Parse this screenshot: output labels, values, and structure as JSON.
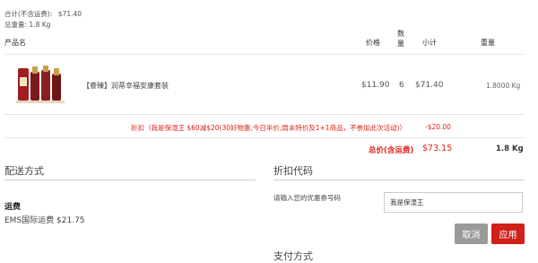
{
  "summary": {
    "subtotal_label": "合计(不含运费):",
    "subtotal_value": "$71.40",
    "weight_label": "总重量: 1.8 Kg"
  },
  "table": {
    "headers": {
      "product": "产品名",
      "price": "价格",
      "qty": "数\n量",
      "subtotal": "小计",
      "weight": "重量"
    },
    "rows": [
      {
        "name": "【睿臻】润蒂幸福安康套装",
        "price": "$11.90",
        "qty": "6",
        "subtotal": "$71.40",
        "weight": "1.8000 Kg"
      }
    ],
    "discount_text": "折扣（我是保湿王 $60减$20(30好物惠,今日半价,周末特价及1+1商品，不参加此次活动)）",
    "discount_value": "-$20.00",
    "total_label": "总价(含运费)",
    "total_value": "$73.15",
    "total_weight": "1.8 Kg"
  },
  "shipping": {
    "title": "配送方式",
    "fee_label": "运费",
    "method": "EMS国际运费 $21.75"
  },
  "coupon": {
    "title": "折扣代码",
    "prompt": "请输入您的优惠券号码",
    "input_value": "我是保湿王",
    "cancel_label": "取消",
    "apply_label": "应用"
  },
  "payment": {
    "title": "支付方式"
  },
  "colors": {
    "accent_red": "#e2231a",
    "cancel_gray": "#9a9a9a",
    "apply_red": "#d0201a"
  }
}
